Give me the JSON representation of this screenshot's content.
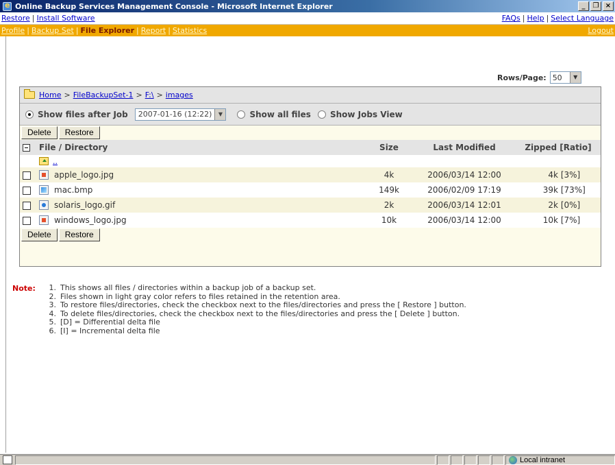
{
  "window": {
    "title": "Online Backup Services Management Console - Microsoft Internet Explorer",
    "buttons": [
      "_",
      "×"
    ]
  },
  "topnav": {
    "left": [
      "Restore",
      "Install Software"
    ],
    "right": [
      "FAQs",
      "Help",
      "Select Language"
    ]
  },
  "mainnav": {
    "left": [
      "Profile",
      "Backup Set",
      "File Explorer",
      "Report",
      "Statistics"
    ],
    "active": "File Explorer",
    "right": "Logout"
  },
  "rows_per_page": {
    "label": "Rows/Page:",
    "value": "50"
  },
  "breadcrumb": [
    "Home",
    "FileBackupSet-1",
    "F:\\",
    "images"
  ],
  "filters": {
    "after_job_label": "Show files after Job",
    "job_value": "2007-01-16 (12:22)",
    "all_files_label": "Show all files",
    "jobs_view_label": "Show Jobs View"
  },
  "actions": {
    "delete": "Delete",
    "restore": "Restore"
  },
  "table": {
    "headers": {
      "name": "File / Directory",
      "size": "Size",
      "modified": "Last Modified",
      "zipped": "Zipped [Ratio]"
    },
    "parent_link": "..",
    "rows": [
      {
        "name": "apple_logo.jpg",
        "size": "4k",
        "modified": "2006/03/14 12:00",
        "zipped": "4k",
        "ratio": "[3%]",
        "icon": "jpg-file-icon"
      },
      {
        "name": "mac.bmp",
        "size": "149k",
        "modified": "2006/02/09 17:19",
        "zipped": "39k",
        "ratio": "[73%]",
        "icon": "bmp-file-icon"
      },
      {
        "name": "solaris_logo.gif",
        "size": "2k",
        "modified": "2006/03/14 12:01",
        "zipped": "2k",
        "ratio": "[0%]",
        "icon": "gif-file-icon"
      },
      {
        "name": "windows_logo.jpg",
        "size": "10k",
        "modified": "2006/03/14 12:00",
        "zipped": "10k",
        "ratio": "[7%]",
        "icon": "jpg-file-icon"
      }
    ]
  },
  "notes": {
    "label": "Note:",
    "items": [
      {
        "num": "1.",
        "text": "This shows all files / directories within a backup job of a backup set."
      },
      {
        "num": "2.",
        "text": "Files shown in light gray color refers to files retained in the retention area."
      },
      {
        "num": "3.",
        "text": "To restore files/directories, check the checkbox next to the files/directories and press the [ Restore ] button."
      },
      {
        "num": "4.",
        "text": "To delete files/directories, check the checkbox next to the files/directories and press the [ Delete ] button."
      },
      {
        "num": "5.",
        "text": "[D] = Differential delta file"
      },
      {
        "num": "6.",
        "text": "[I] = Incremental delta file"
      }
    ]
  },
  "statusbar": {
    "zone": "Local intranet"
  },
  "colors": {
    "nav_orange": "#f0a800",
    "note_red": "#cc0000",
    "link_blue": "#0000cc"
  }
}
